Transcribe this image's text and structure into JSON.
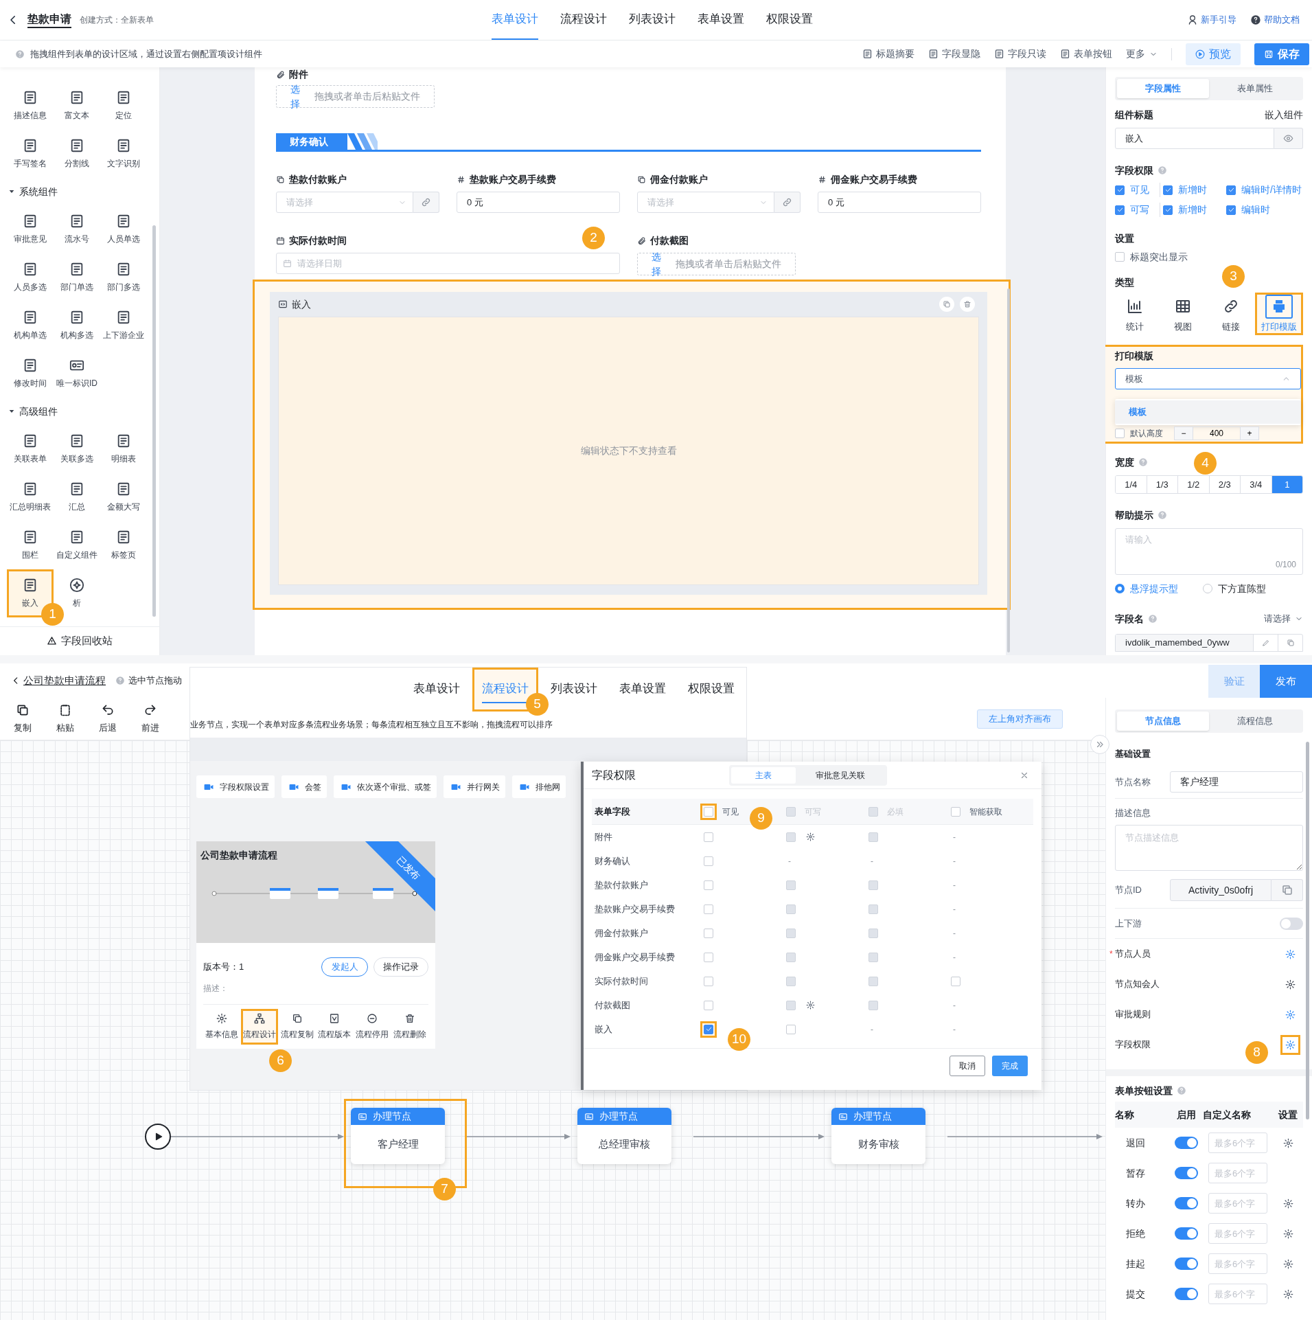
{
  "form_designer": {
    "title": "垫款申请",
    "subtitle": "创建方式：全新表单",
    "tabs": [
      {
        "label": "表单设计",
        "selected": true
      },
      {
        "label": "流程设计",
        "selected": false
      },
      {
        "label": "列表设计",
        "selected": false
      },
      {
        "label": "表单设置",
        "selected": false
      },
      {
        "label": "权限设置",
        "selected": false
      }
    ],
    "help_links": [
      "新手引导",
      "帮助文档"
    ],
    "hint": "拖拽组件到表单的设计区域，通过设置右侧配置项设计组件",
    "tools": [
      "标题摘要",
      "字段显隐",
      "字段只读",
      "表单按钮"
    ],
    "more": "更多",
    "preview": "预览",
    "save": "保存",
    "palette": {
      "groups": [
        {
          "items": [
            {
              "label": "描述信息",
              "highlighted": false
            },
            {
              "label": "富文本",
              "highlighted": false
            },
            {
              "label": "定位",
              "highlighted": false
            },
            {
              "label": "手写签名",
              "highlighted": false
            },
            {
              "label": "分割线",
              "highlighted": false
            },
            {
              "label": "文字识别",
              "highlighted": false
            }
          ]
        },
        {
          "title": "系统组件",
          "expanded": true,
          "items": [
            {
              "label": "审批意见",
              "highlighted": false
            },
            {
              "label": "流水号",
              "highlighted": false
            },
            {
              "label": "人员单选",
              "highlighted": false
            },
            {
              "label": "人员多选",
              "highlighted": false
            },
            {
              "label": "部门单选",
              "highlighted": false
            },
            {
              "label": "部门多选",
              "highlighted": false
            },
            {
              "label": "机构单选",
              "highlighted": false
            },
            {
              "label": "机构多选",
              "highlighted": false
            },
            {
              "label": "上下游企业",
              "highlighted": false
            },
            {
              "label": "修改时间",
              "highlighted": false
            },
            {
              "label": "唯一标识ID",
              "highlighted": false
            }
          ]
        },
        {
          "title": "高级组件",
          "expanded": true,
          "items": [
            {
              "label": "关联表单",
              "highlighted": false
            },
            {
              "label": "关联多选",
              "highlighted": false
            },
            {
              "label": "明细表",
              "highlighted": false
            },
            {
              "label": "汇总明细表",
              "highlighted": false
            },
            {
              "label": "汇总",
              "highlighted": false
            },
            {
              "label": "金额大写",
              "highlighted": false
            },
            {
              "label": "围栏",
              "highlighted": false
            },
            {
              "label": "自定义组件",
              "highlighted": false
            },
            {
              "label": "标签页",
              "highlighted": false
            },
            {
              "label": "嵌入",
              "highlighted": true
            },
            {
              "label": "析",
              "highlighted": false
            }
          ]
        }
      ],
      "recycle": "字段回收站"
    },
    "canvas": {
      "attachment": {
        "label": "附件",
        "choose": "选择",
        "hint": "拖拽或者单击后粘贴文件"
      },
      "section": {
        "title": "财务确认"
      },
      "fields": [
        {
          "kind": "select",
          "label": "垫款付款账户",
          "placeholder": "请选择"
        },
        {
          "kind": "number",
          "label": "垫款账户交易手续费",
          "value": "0 元"
        },
        {
          "kind": "select",
          "label": "佣金付款账户",
          "placeholder": "请选择"
        },
        {
          "kind": "number",
          "label": "佣金账户交易手续费",
          "value": "0 元"
        },
        {
          "kind": "date",
          "label": "实际付款时间",
          "placeholder": "请选择日期"
        },
        {
          "kind": "upload",
          "label": "付款截图",
          "choose": "选择",
          "hint": "拖拽或者单击后粘贴文件"
        }
      ],
      "embed": {
        "title": "嵌入",
        "message": "编辑状态下不支持查看",
        "highlighted": true
      }
    },
    "properties": {
      "tabs": [
        {
          "label": "字段属性",
          "selected": true
        },
        {
          "label": "表单属性",
          "selected": false
        }
      ],
      "title_label": "组件标题",
      "component_type": "嵌入组件",
      "title_value": "嵌入",
      "permissions_label": "字段权限",
      "permissions": [
        {
          "items": [
            {
              "label": "可见",
              "checked": true
            },
            {
              "label": "新增时",
              "checked": true
            },
            {
              "label": "编辑时/详情时",
              "checked": true
            }
          ]
        },
        {
          "items": [
            {
              "label": "可写",
              "checked": true
            },
            {
              "label": "新增时",
              "checked": true
            },
            {
              "label": "编辑时",
              "checked": true
            }
          ]
        }
      ],
      "settings_label": "设置",
      "settings": [
        {
          "label": "标题突出显示",
          "checked": false
        }
      ],
      "type_label": "类型",
      "types": [
        {
          "label": "统计",
          "selected": false,
          "highlighted": false
        },
        {
          "label": "视图",
          "selected": false,
          "highlighted": false
        },
        {
          "label": "链接",
          "selected": false,
          "highlighted": false
        },
        {
          "label": "打印模版",
          "selected": true,
          "highlighted": true
        }
      ],
      "print_template": {
        "label": "打印模版",
        "value": "模板",
        "expanded": true,
        "highlighted": true,
        "options": [
          {
            "label": "模板",
            "selected": true
          }
        ]
      },
      "default_height": {
        "label": "默认高度",
        "checked": false,
        "minus": "−",
        "value": "400",
        "plus": "+"
      },
      "width_label": "宽度",
      "widths": [
        {
          "label": "1/4",
          "selected": false
        },
        {
          "label": "1/3",
          "selected": false
        },
        {
          "label": "1/2",
          "selected": false
        },
        {
          "label": "2/3",
          "selected": false
        },
        {
          "label": "3/4",
          "selected": false
        },
        {
          "label": "1",
          "selected": true
        }
      ],
      "help_label": "帮助提示",
      "help_placeholder": "请输入",
      "help_counter": "0/100",
      "help_styles": [
        {
          "label": "悬浮提示型",
          "selected": true
        },
        {
          "label": "下方直陈型",
          "selected": false
        }
      ],
      "field_name_label": "字段名",
      "field_name_mode": "请选择",
      "field_name_value": "ivdolik_mamembed_0yww"
    }
  },
  "flow_designer": {
    "title": "公司垫款申请流程",
    "hint": "选中节点拖动",
    "verify": "验证",
    "publish": "发布",
    "tools": [
      "复制",
      "粘贴",
      "后退",
      "前进"
    ],
    "align": "左上角对齐画布",
    "nodes": [
      {
        "type": "办理节点",
        "name": "客户经理",
        "highlighted": true
      },
      {
        "type": "办理节点",
        "name": "总经理审核",
        "highlighted": false
      },
      {
        "type": "办理节点",
        "name": "财务审核",
        "highlighted": false
      }
    ],
    "panel": {
      "tabs": [
        {
          "label": "节点信息",
          "selected": true
        },
        {
          "label": "流程信息",
          "selected": false
        }
      ],
      "section": "基础设置",
      "node_name_label": "节点名称",
      "node_name": "客户经理",
      "desc_label": "描述信息",
      "desc_placeholder": "节点描述信息",
      "id_label": "节点ID",
      "id": "Activity_0s0ofrj",
      "upstream_label": "上下游",
      "upstream_on": false,
      "settings": [
        {
          "label": "节点人员",
          "required_mark": "*",
          "configured": true,
          "highlighted": false
        },
        {
          "label": "节点知会人",
          "configured": false,
          "highlighted": false
        },
        {
          "label": "审批规则",
          "configured": true,
          "highlighted": false
        },
        {
          "label": "字段权限",
          "configured": true,
          "highlighted": true
        }
      ],
      "buttons_label": "表单按钮设置",
      "button_columns": [
        "名称",
        "启用",
        "自定义名称",
        "设置"
      ],
      "buttons": [
        {
          "name": "退回",
          "on": true,
          "placeholder": "最多6个字",
          "has_settings": true
        },
        {
          "name": "暂存",
          "on": true,
          "placeholder": "最多6个字",
          "has_settings": false
        },
        {
          "name": "转办",
          "on": true,
          "placeholder": "最多6个字",
          "has_settings": true
        },
        {
          "name": "拒绝",
          "on": true,
          "placeholder": "最多6个字",
          "has_settings": true
        },
        {
          "name": "挂起",
          "on": true,
          "placeholder": "最多6个字",
          "has_settings": true
        },
        {
          "name": "提交",
          "on": true,
          "placeholder": "最多6个字",
          "has_settings": true
        }
      ]
    }
  },
  "process_list": {
    "tabs": [
      {
        "label": "表单设计",
        "selected": false,
        "highlighted": false
      },
      {
        "label": "流程设计",
        "selected": true,
        "highlighted": true
      },
      {
        "label": "列表设计",
        "selected": false,
        "highlighted": false
      },
      {
        "label": "表单设置",
        "selected": false,
        "highlighted": false
      },
      {
        "label": "权限设置",
        "selected": false,
        "highlighted": false
      }
    ],
    "hint": "业务节点，实现一个表单对应多条流程业务场景；每条流程相互独立且互不影响，拖拽流程可以排序",
    "videos": [
      "字段权限设置",
      "会签",
      "依次逐个审批、或签",
      "并行网关",
      "排他网"
    ],
    "card": {
      "title": "公司垫款申请流程",
      "status": "已发布",
      "version": "版本号：1",
      "starter": "发起人",
      "log": "操作记录",
      "desc": "描述：",
      "actions": [
        {
          "label": "基本信息",
          "highlighted": false
        },
        {
          "label": "流程设计",
          "highlighted": true
        },
        {
          "label": "流程复制",
          "highlighted": false
        },
        {
          "label": "流程版本",
          "highlighted": false
        },
        {
          "label": "流程停用",
          "highlighted": false
        },
        {
          "label": "流程删除",
          "highlighted": false
        }
      ]
    }
  },
  "permission_dialog": {
    "title": "字段权限",
    "tabs": [
      {
        "label": "主表",
        "selected": true
      },
      {
        "label": "审批意见关联",
        "selected": false
      }
    ],
    "field_header": "表单字段",
    "columns": [
      {
        "label": "可见",
        "checked": false,
        "disabled": false,
        "highlighted": true
      },
      {
        "label": "可写",
        "checked": false,
        "disabled": true,
        "highlighted": false
      },
      {
        "label": "必填",
        "checked": false,
        "disabled": true,
        "highlighted": false
      },
      {
        "label": "智能获取",
        "checked": false,
        "disabled": false,
        "highlighted": false
      }
    ],
    "rows": [
      {
        "field": "附件",
        "cells": [
          {
            "kind": "checkbox",
            "checked": false,
            "disabled": false,
            "highlighted": false
          },
          {
            "kind": "checkbox",
            "checked": false,
            "disabled": true,
            "settings": true,
            "highlighted": false
          },
          {
            "kind": "checkbox",
            "checked": false,
            "disabled": true,
            "highlighted": false
          },
          {
            "kind": "dash",
            "text": "-"
          }
        ]
      },
      {
        "field": "财务确认",
        "cells": [
          {
            "kind": "checkbox",
            "checked": false,
            "disabled": false,
            "highlighted": false
          },
          {
            "kind": "dash",
            "text": "-"
          },
          {
            "kind": "dash",
            "text": "-"
          },
          {
            "kind": "dash",
            "text": "-"
          }
        ]
      },
      {
        "field": "垫款付款账户",
        "cells": [
          {
            "kind": "checkbox",
            "checked": false,
            "disabled": false,
            "highlighted": false
          },
          {
            "kind": "checkbox",
            "checked": false,
            "disabled": true,
            "highlighted": false
          },
          {
            "kind": "checkbox",
            "checked": false,
            "disabled": true,
            "highlighted": false
          },
          {
            "kind": "dash",
            "text": "-"
          }
        ]
      },
      {
        "field": "垫款账户交易手续费",
        "cells": [
          {
            "kind": "checkbox",
            "checked": false,
            "disabled": false,
            "highlighted": false
          },
          {
            "kind": "checkbox",
            "checked": false,
            "disabled": true,
            "highlighted": false
          },
          {
            "kind": "checkbox",
            "checked": false,
            "disabled": true,
            "highlighted": false
          },
          {
            "kind": "dash",
            "text": "-"
          }
        ]
      },
      {
        "field": "佣金付款账户",
        "cells": [
          {
            "kind": "checkbox",
            "checked": false,
            "disabled": false,
            "highlighted": false
          },
          {
            "kind": "checkbox",
            "checked": false,
            "disabled": true,
            "highlighted": false
          },
          {
            "kind": "checkbox",
            "checked": false,
            "disabled": true,
            "highlighted": false
          },
          {
            "kind": "dash",
            "text": "-"
          }
        ]
      },
      {
        "field": "佣金账户交易手续费",
        "cells": [
          {
            "kind": "checkbox",
            "checked": false,
            "disabled": false,
            "highlighted": false
          },
          {
            "kind": "checkbox",
            "checked": false,
            "disabled": true,
            "highlighted": false
          },
          {
            "kind": "checkbox",
            "checked": false,
            "disabled": true,
            "highlighted": false
          },
          {
            "kind": "dash",
            "text": "-"
          }
        ]
      },
      {
        "field": "实际付款时间",
        "cells": [
          {
            "kind": "checkbox",
            "checked": false,
            "disabled": false,
            "highlighted": false
          },
          {
            "kind": "checkbox",
            "checked": false,
            "disabled": true,
            "highlighted": false
          },
          {
            "kind": "checkbox",
            "checked": false,
            "disabled": true,
            "highlighted": false
          },
          {
            "kind": "checkbox",
            "checked": false,
            "disabled": false,
            "highlighted": false
          }
        ]
      },
      {
        "field": "付款截图",
        "cells": [
          {
            "kind": "checkbox",
            "checked": false,
            "disabled": false,
            "highlighted": false
          },
          {
            "kind": "checkbox",
            "checked": false,
            "disabled": true,
            "settings": true,
            "highlighted": false
          },
          {
            "kind": "checkbox",
            "checked": false,
            "disabled": true,
            "highlighted": false
          },
          {
            "kind": "dash",
            "text": "-"
          }
        ]
      },
      {
        "field": "嵌入",
        "cells": [
          {
            "kind": "checkbox",
            "checked": true,
            "disabled": false,
            "highlighted": true
          },
          {
            "kind": "checkbox",
            "checked": false,
            "disabled": false,
            "highlighted": false
          },
          {
            "kind": "dash",
            "text": "-"
          },
          {
            "kind": "dash",
            "text": "-"
          }
        ]
      }
    ],
    "cancel": "取消",
    "done": "完成"
  },
  "annotations": [
    {
      "label": "1"
    },
    {
      "label": "2"
    },
    {
      "label": "3"
    },
    {
      "label": "4"
    },
    {
      "label": "5"
    },
    {
      "label": "6"
    },
    {
      "label": "7"
    },
    {
      "label": "8"
    },
    {
      "label": "9"
    },
    {
      "label": "10"
    }
  ]
}
